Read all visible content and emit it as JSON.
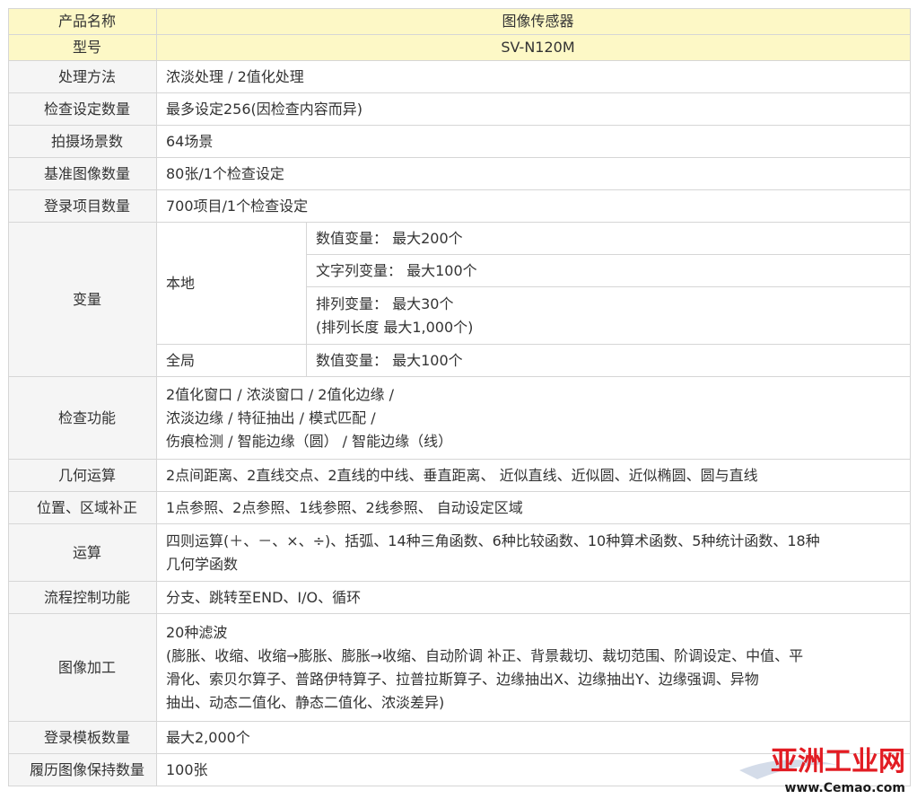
{
  "header": {
    "name_label": "产品名称",
    "name_value": "图像传感器",
    "model_label": "型号",
    "model_value": "SV-N120M"
  },
  "rows": {
    "processing": {
      "label": "处理方法",
      "value": "浓淡处理 / 2值化处理"
    },
    "inspection_settings": {
      "label": "检查设定数量",
      "value": "最多设定256(因检查内容而异)"
    },
    "scenes": {
      "label": "拍摄场景数",
      "value": "64场景"
    },
    "reference_images": {
      "label": "基准图像数量",
      "value": "80张/1个检查设定"
    },
    "registered_items": {
      "label": "登录项目数量",
      "value": "700项目/1个检查设定"
    },
    "variables": {
      "label": "变量",
      "local_label": "本地",
      "numeric_local": "数值变量：  最大200个",
      "string_local": "文字列变量：  最大100个",
      "array_local_1": "排列变量：  最大30个",
      "array_local_2": "(排列长度    最大1,000个)",
      "global_label": "全局",
      "numeric_global": "数值变量：  最大100个"
    },
    "inspection_functions": {
      "label": "检查功能",
      "lines": [
        "2值化窗口 / 浓淡窗口 / 2值化边缘 /",
        "浓淡边缘 / 特征抽出 / 模式匹配 /",
        "伤痕检测 / 智能边缘（圆） / 智能边缘（线）"
      ]
    },
    "geometry": {
      "label": "几何运算",
      "value": "2点间距离、2直线交点、2直线的中线、垂直距离、 近似直线、近似圆、近似椭圆、圆与直线"
    },
    "position_correction": {
      "label": "位置、区域补正",
      "value": "1点参照、2点参照、1线参照、2线参照、 自动设定区域"
    },
    "calculation": {
      "label": "运算",
      "lines": [
        "四则运算(＋、－、×、÷)、括弧、14种三角函数、6种比较函数、10种算术函数、5种统计函数、18种",
        "几何学函数"
      ]
    },
    "flow_control": {
      "label": "流程控制功能",
      "value": "分支、跳转至END、I/O、循环"
    },
    "image_processing": {
      "label": "图像加工",
      "lines": [
        "20种滤波",
        "(膨胀、收缩、收缩→膨胀、膨胀→收缩、自动阶调 补正、背景裁切、裁切范围、阶调设定、中值、平",
        "滑化、索贝尔算子、普路伊特算子、拉普拉斯算子、边缘抽出X、边缘抽出Y、边缘强调、异物",
        "抽出、动态二值化、静态二值化、浓淡差异)"
      ]
    },
    "templates": {
      "label": "登录模板数量",
      "value": "最大2,000个"
    },
    "history": {
      "label": "履历图像保持数量",
      "value": "100张"
    }
  },
  "watermark": {
    "text": "亚洲工业网",
    "url": "www.Cemao.com"
  }
}
